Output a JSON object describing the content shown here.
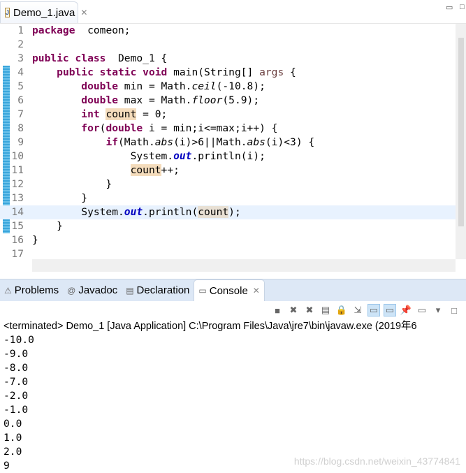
{
  "editor_tab": {
    "title": "Demo_1.java",
    "icon": "java-file-icon"
  },
  "code": [
    [
      [
        "kw",
        "package"
      ],
      [
        "",
        "  comeon;"
      ]
    ],
    [],
    [
      [
        "kw",
        "public class"
      ],
      [
        "",
        "  Demo_1 {"
      ]
    ],
    [
      [
        "",
        "    "
      ],
      [
        "kw",
        "public static void"
      ],
      [
        "",
        " main(String[] "
      ],
      [
        "prm",
        "args"
      ],
      [
        "",
        " {"
      ]
    ],
    [
      [
        "",
        "        "
      ],
      [
        "kw",
        "double"
      ],
      [
        "",
        " min = Math."
      ],
      [
        "fn",
        "ceil"
      ],
      [
        "",
        "(-10.8);"
      ]
    ],
    [
      [
        "",
        "        "
      ],
      [
        "kw",
        "double"
      ],
      [
        "",
        " max = Math."
      ],
      [
        "fn",
        "floor"
      ],
      [
        "",
        "(5.9);"
      ]
    ],
    [
      [
        "",
        "        "
      ],
      [
        "kw",
        "int"
      ],
      [
        "",
        " "
      ],
      [
        "occ",
        "count"
      ],
      [
        "",
        " = 0;"
      ]
    ],
    [
      [
        "",
        "        "
      ],
      [
        "kw",
        "for"
      ],
      [
        "",
        "("
      ],
      [
        "kw",
        "double"
      ],
      [
        "",
        " i = min;i<=max;i++) {"
      ]
    ],
    [
      [
        "",
        "            "
      ],
      [
        "kw",
        "if"
      ],
      [
        "",
        "(Math."
      ],
      [
        "fn",
        "abs"
      ],
      [
        "",
        "(i)>6||Math."
      ],
      [
        "fn",
        "abs"
      ],
      [
        "",
        "(i)<3) {"
      ]
    ],
    [
      [
        "",
        "                System."
      ],
      [
        "fld",
        "out"
      ],
      [
        "",
        ".println(i);"
      ]
    ],
    [
      [
        "",
        "                "
      ],
      [
        "occ",
        "count"
      ],
      [
        "",
        "++;"
      ]
    ],
    [
      [
        "",
        "            }"
      ]
    ],
    [
      [
        "",
        "        }"
      ]
    ],
    [
      [
        "",
        "        System."
      ],
      [
        "fld",
        "out"
      ],
      [
        "",
        ".println("
      ],
      [
        "occc",
        "count"
      ],
      [
        "",
        ");"
      ]
    ],
    [
      [
        "",
        "    }"
      ]
    ],
    [
      [
        "",
        "}"
      ]
    ],
    []
  ],
  "current_line": 14,
  "console_panel": {
    "tabs": [
      {
        "label": "Problems",
        "icon": "problems-icon"
      },
      {
        "label": "Javadoc",
        "icon": "at-icon"
      },
      {
        "label": "Declaration",
        "icon": "declaration-icon"
      },
      {
        "label": "Console",
        "icon": "console-icon",
        "active": true
      }
    ],
    "status": "<terminated> Demo_1 [Java Application] C:\\Program Files\\Java\\jre7\\bin\\javaw.exe (2019年6",
    "output": [
      "-10.0",
      "-9.0",
      "-8.0",
      "-7.0",
      "-2.0",
      "-1.0",
      "0.0",
      "1.0",
      "2.0",
      "9"
    ]
  },
  "watermark": "https://blog.csdn.net/weixin_43774841"
}
